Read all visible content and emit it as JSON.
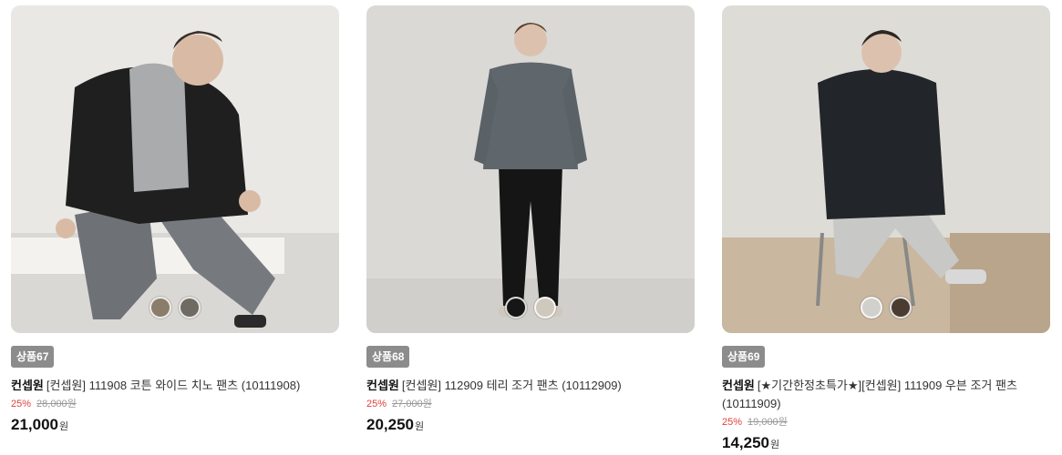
{
  "products": [
    {
      "badge": "상품67",
      "brand": "컨셉원",
      "name": "[컨셉원] 111908 코튼 와이드 치노 팬츠 (10111908)",
      "discount": "25%",
      "original_price": "28,000원",
      "price": "21,000",
      "currency": "원",
      "swatches": [
        "#8a7d6a",
        "#6f6a62"
      ]
    },
    {
      "badge": "상품68",
      "brand": "컨셉원",
      "name": "[컨셉원] 112909 테리 조거 팬츠 (10112909)",
      "discount": "25%",
      "original_price": "27,000원",
      "price": "20,250",
      "currency": "원",
      "swatches": [
        "#161616",
        "#cfc8bd"
      ]
    },
    {
      "badge": "상품69",
      "brand": "컨셉원",
      "name": "[★기간한정초특가★][컨셉원] 111909 우븐 조거 팬츠 (10111909)",
      "discount": "25%",
      "original_price": "19,000원",
      "price": "14,250",
      "currency": "원",
      "swatches": [
        "#d2d0cc",
        "#4a3c30"
      ]
    }
  ]
}
